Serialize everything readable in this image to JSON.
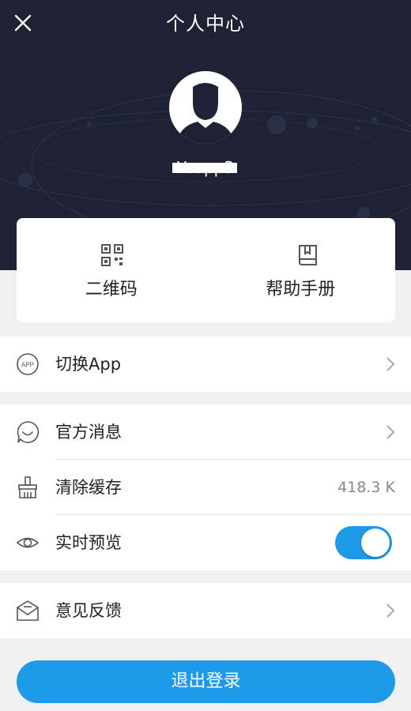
{
  "header": {
    "title": "个人中心",
    "username": "Yoapp3"
  },
  "quick_actions": [
    {
      "label": "二维码",
      "icon": "qr-code-icon"
    },
    {
      "label": "帮助手册",
      "icon": "book-icon"
    }
  ],
  "menu": {
    "switch_app": {
      "label": "切换App",
      "icon_text": "APP"
    },
    "official_messages": {
      "label": "官方消息"
    },
    "clear_cache": {
      "label": "清除缓存",
      "value": "418.3 K"
    },
    "live_preview": {
      "label": "实时预览",
      "enabled": true
    },
    "feedback": {
      "label": "意见反馈"
    }
  },
  "logout_label": "退出登录",
  "colors": {
    "header_bg": "#1f2235",
    "accent": "#1e9be8",
    "page_bg": "#f0f0f0"
  }
}
